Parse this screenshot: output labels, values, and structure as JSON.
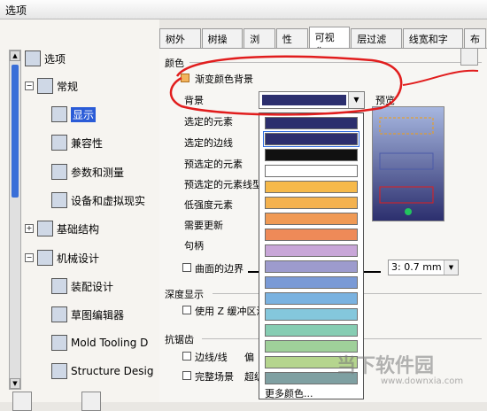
{
  "window": {
    "title": "选项"
  },
  "tree": {
    "nodes": [
      {
        "label": "选项"
      },
      {
        "label": "常规"
      },
      {
        "label": "显示"
      },
      {
        "label": "兼容性"
      },
      {
        "label": "参数和测量"
      },
      {
        "label": "设备和虚拟现实"
      },
      {
        "label": "基础结构"
      },
      {
        "label": "机械设计"
      },
      {
        "label": "装配设计"
      },
      {
        "label": "草图编辑器"
      },
      {
        "label": "Mold Tooling D"
      },
      {
        "label": "Structure Desig"
      }
    ]
  },
  "tabs": [
    "树外观",
    "树操作",
    "浏览",
    "性能",
    "可视化",
    "层过滤器",
    "线宽和字体",
    "布"
  ],
  "color_section": {
    "title": "颜色",
    "gradient_label": "渐变颜色背景",
    "background_label": "背景",
    "preview_label": "预览",
    "rows": [
      "选定的元素",
      "选定的边线",
      "预选定的元素",
      "预选定的元素线型",
      "低强度元素",
      "需要更新",
      "句柄"
    ],
    "curve_border_label": "曲面的边界",
    "line_value": "3: 0.7 mm"
  },
  "dropdown": {
    "swatches": [
      "#2c2f6e",
      "#2c2f6e",
      "#111111",
      "#ffffff",
      "#f6b94a",
      "#f4b24f",
      "#f09a55",
      "#ee8a58",
      "#c8a6d8",
      "#9d9bcd",
      "#7a9ad6",
      "#7ab2e0",
      "#84c7dc",
      "#86cdb3",
      "#9fd09a",
      "#b5d58e",
      "#7fa0a2"
    ],
    "more_label": "更多颜色..."
  },
  "depth_section": {
    "title": "深度显示",
    "zbuffer_label": "使用 Z 缓冲区深"
  },
  "aa_section": {
    "title": "抗锯齿",
    "edges_label": "边线/线",
    "fullscene_label": "完整场景",
    "offset_label": "偏",
    "super_label": "超级"
  },
  "watermark": {
    "brand": "当下软件园",
    "url": "www.downxia.com"
  },
  "colors": {
    "accent": "#2a5bd7",
    "annotation": "#e11d1d"
  }
}
